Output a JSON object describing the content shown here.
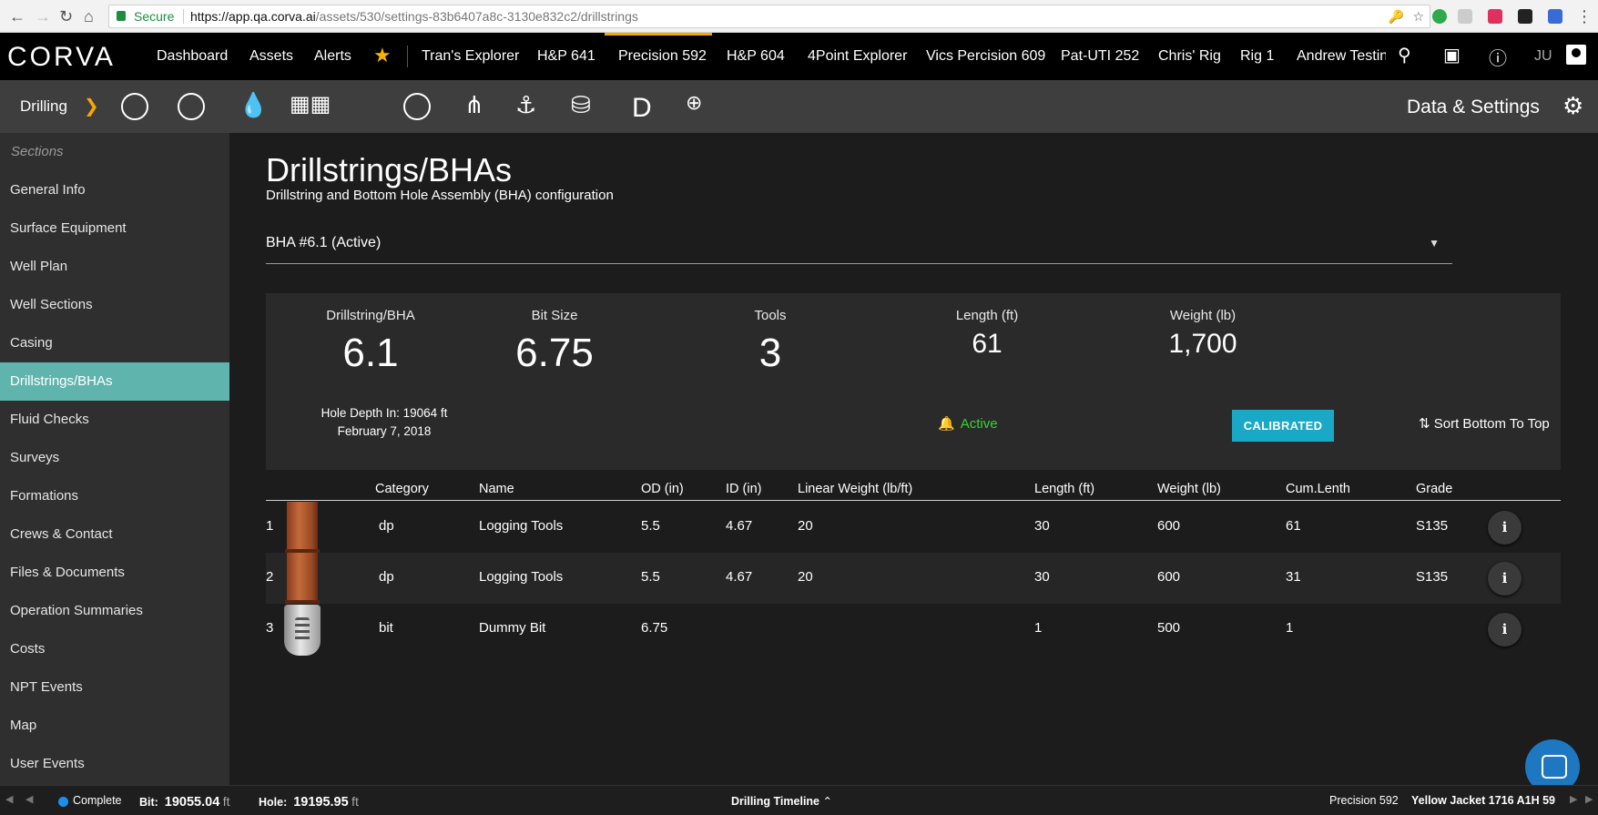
{
  "browser": {
    "secure_label": "Secure",
    "url_host": "https://app.qa.corva.ai",
    "url_path": "/assets/530/settings-83b6407a8c-3130e832c2/drillstrings"
  },
  "topnav": {
    "logo": "CORVA",
    "items": [
      "Dashboard",
      "Assets",
      "Alerts"
    ],
    "rigs": [
      "Tran's Explorer",
      "H&P 641",
      "Precision 592",
      "H&P 604",
      "4Point Explorer",
      "Vics Percision 609",
      "Pat-UTI 252",
      "Chris' Rig",
      "Rig 1",
      "Andrew Testing"
    ],
    "user_initials": "JU"
  },
  "subnav": {
    "segment": "Drilling",
    "data_settings": "Data & Settings"
  },
  "sidebar": {
    "title": "Sections",
    "items": [
      "General Info",
      "Surface Equipment",
      "Well Plan",
      "Well Sections",
      "Casing",
      "Drillstrings/BHAs",
      "Fluid Checks",
      "Surveys",
      "Formations",
      "Crews & Contact",
      "Files & Documents",
      "Operation Summaries",
      "Costs",
      "NPT Events",
      "Map",
      "User Events"
    ],
    "active": "Drillstrings/BHAs"
  },
  "page": {
    "title": "Drillstrings/BHAs",
    "subtitle": "Drillstring and Bottom Hole Assembly (BHA) configuration",
    "selected_bha": "BHA #6.1 (Active)"
  },
  "summary": {
    "drillstring_label": "Drillstring/BHA",
    "drillstring_value": "6.1",
    "bitsize_label": "Bit Size",
    "bitsize_value": "6.75",
    "tools_label": "Tools",
    "tools_value": "3",
    "length_label": "Length (ft)",
    "length_value": "61",
    "weight_label": "Weight (lb)",
    "weight_value": "1,700",
    "hole_depth": "Hole Depth In: 19064 ft",
    "date": "February 7, 2018",
    "status": "Active",
    "calibrated": "CALIBRATED",
    "sort": "Sort Bottom To Top"
  },
  "table": {
    "headers": [
      "Category",
      "Name",
      "OD (in)",
      "ID (in)",
      "Linear Weight (lb/ft)",
      "Length (ft)",
      "Weight (lb)",
      "Cum.Lenth",
      "Grade"
    ],
    "rows": [
      {
        "num": "1",
        "category": "dp",
        "name": "Logging Tools",
        "od": "5.5",
        "id": "4.67",
        "linear": "20",
        "length": "30",
        "weight": "600",
        "cum": "61",
        "grade": "S135",
        "img": "pipe"
      },
      {
        "num": "2",
        "category": "dp",
        "name": "Logging Tools",
        "od": "5.5",
        "id": "4.67",
        "linear": "20",
        "length": "30",
        "weight": "600",
        "cum": "31",
        "grade": "S135",
        "img": "pipe"
      },
      {
        "num": "3",
        "category": "bit",
        "name": "Dummy Bit",
        "od": "6.75",
        "id": "",
        "linear": "",
        "length": "1",
        "weight": "500",
        "cum": "1",
        "grade": "",
        "img": "bit"
      }
    ]
  },
  "footer": {
    "status": "Complete",
    "bit_label": "Bit:",
    "bit_value": "19055.04",
    "hole_label": "Hole:",
    "hole_value": "19195.95",
    "unit": "ft",
    "timeline": "Drilling Timeline",
    "rig": "Precision 592",
    "well": "Yellow Jacket 1716 A1H 59"
  }
}
